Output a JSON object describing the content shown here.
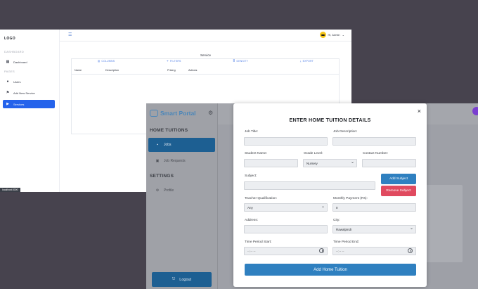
{
  "admin": {
    "logo": "LOGO",
    "sections": [
      "DASHBOARD",
      "PAGES"
    ],
    "nav": [
      {
        "label": "Dashboard",
        "icon": "dashboard-icon"
      },
      {
        "label": "Users",
        "icon": "user-icon"
      },
      {
        "label": "Add New Service",
        "icon": "pin-icon"
      },
      {
        "label": "Services",
        "icon": "play-icon"
      }
    ],
    "user_greeting": "Hi, Admin",
    "status_url": "localhost:3000",
    "table": {
      "title": "Service",
      "toolbar": [
        "COLUMNS",
        "FILTERS",
        "DENSITY",
        "EXPORT"
      ],
      "columns": [
        "Name",
        "Description",
        "Pricing",
        "Actions"
      ]
    }
  },
  "portal": {
    "brand": "Smart Portal",
    "sections": [
      "HOME TUITIONS",
      "SETTINGS"
    ],
    "nav": [
      {
        "label": "Jobs",
        "active": true
      },
      {
        "label": "Job Requests",
        "active": false
      },
      {
        "label": "Profile",
        "active": false
      }
    ],
    "logout": "Logout",
    "accent": "#1d5f92"
  },
  "modal": {
    "title": "ENTER HOME TUITION DETAILS",
    "close": "×",
    "fields": {
      "job_title": {
        "label": "Job Title:",
        "value": ""
      },
      "job_description": {
        "label": "Job Description:",
        "value": ""
      },
      "student_name": {
        "label": "Student Name:",
        "value": ""
      },
      "grade_level": {
        "label": "Grade Level:",
        "value": "Nursery"
      },
      "contact_number": {
        "label": "Contact Number:",
        "value": ""
      },
      "subject": {
        "label": "Subject:",
        "value": ""
      },
      "teacher_qualification": {
        "label": "Teacher Qualification:",
        "value": "Any"
      },
      "monthly_payment": {
        "label": "Monthly Payment (Rs):",
        "value": "0"
      },
      "address": {
        "label": "Address:",
        "value": ""
      },
      "city": {
        "label": "City:",
        "value": "Rawalpindi"
      },
      "time_start": {
        "label": "Time Period Start:",
        "value": "--:-- --"
      },
      "time_end": {
        "label": "Time Period End:",
        "value": "--:-- --"
      }
    },
    "add_subject": "Add Subject",
    "remove_subject": "Remove Subject",
    "submit": "Add Home Tuition",
    "primary_color": "#2f80c0",
    "danger_color": "#e04a5f"
  }
}
